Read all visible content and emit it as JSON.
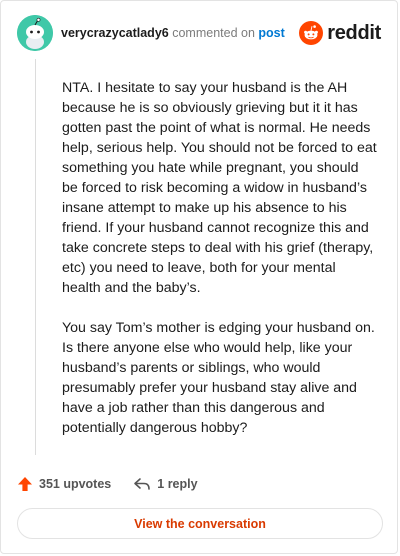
{
  "comment": {
    "username": "verycrazycatlady6",
    "action_text": "commented on",
    "target": "post",
    "paragraphs": [
      "NTA. I hesitate to say your husband is the AH because he is so obviously grieving but it it has gotten past the point of what is normal. He needs help, serious help. You should not be forced to eat something you hate while pregnant, you should be forced to risk becoming a widow in husband’s insane attempt to make up his absence to his friend. If your husband cannot recognize this and take concrete steps to deal with his grief (therapy, etc) you need to leave, both for your mental health and the baby’s.",
      "You say Tom’s mother is edging your husband on. Is there anyone else who would help, like your husband’s parents or siblings, who would presumably prefer your husband stay alive and have a job rather than this dangerous and potentially dangerous hobby?"
    ]
  },
  "brand": {
    "name": "reddit",
    "color": "#ff4500"
  },
  "actions": {
    "upvotes": "351 upvotes",
    "replies": "1 reply"
  },
  "cta": {
    "label": "View the conversation",
    "color": "#d93a00"
  },
  "icons": {
    "avatar": "snoo-avatar-icon",
    "logo": "reddit-logo-icon",
    "upvote": "upvote-arrow-icon",
    "reply": "reply-arrow-icon"
  }
}
